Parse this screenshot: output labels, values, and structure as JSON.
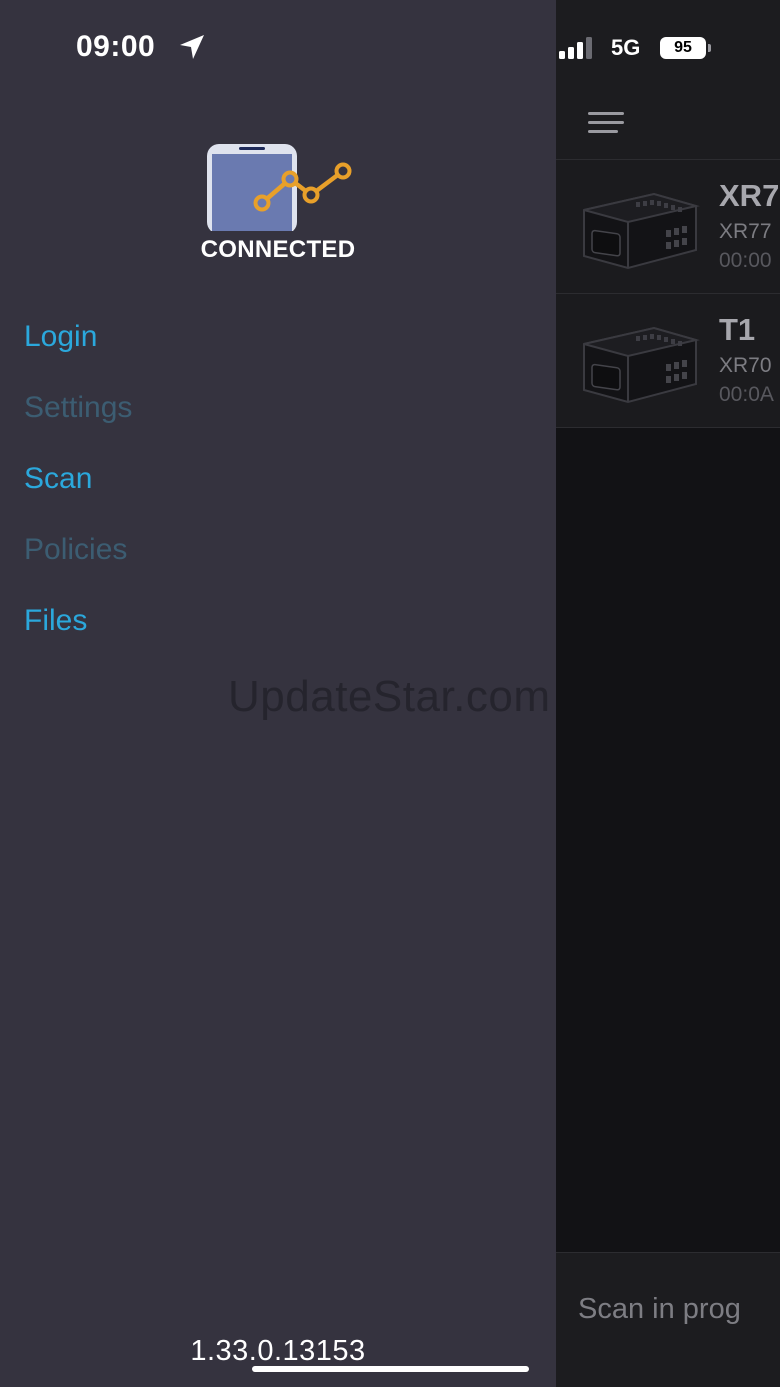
{
  "status_bar": {
    "time": "09:00",
    "network": "5G",
    "battery": "95"
  },
  "drawer": {
    "logo_text": "CONNECTED",
    "menu": [
      {
        "label": "Login",
        "enabled": true
      },
      {
        "label": "Settings",
        "enabled": false
      },
      {
        "label": "Scan",
        "enabled": true
      },
      {
        "label": "Policies",
        "enabled": false
      },
      {
        "label": "Files",
        "enabled": true
      }
    ],
    "watermark": "UpdateStar.com",
    "version": "1.33.0.13153"
  },
  "main": {
    "devices": [
      {
        "name": "XR7",
        "model": "XR77",
        "time": "00:00"
      },
      {
        "name": "T1",
        "model": "XR70",
        "time": "00:0A"
      }
    ],
    "scan_status": "Scan in prog"
  },
  "colors": {
    "drawer_bg": "#35333f",
    "accent": "#2ba8dc",
    "disabled": "#3c5d72",
    "logo_orange": "#e8a02a"
  }
}
